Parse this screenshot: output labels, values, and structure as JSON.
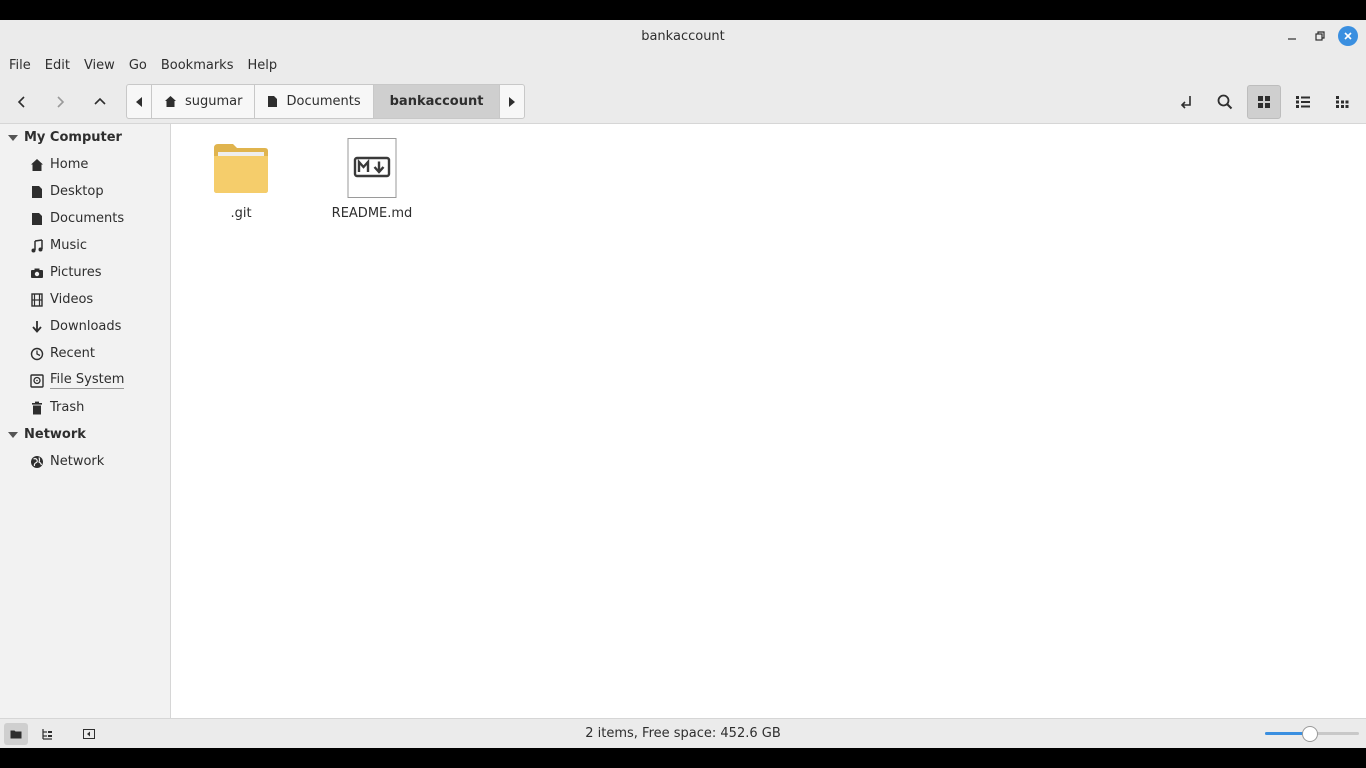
{
  "window": {
    "title": "bankaccount"
  },
  "menu": [
    "File",
    "Edit",
    "View",
    "Go",
    "Bookmarks",
    "Help"
  ],
  "breadcrumb": [
    "sugumar",
    "Documents",
    "bankaccount"
  ],
  "sidebar": {
    "sections": [
      {
        "label": "My Computer",
        "items": [
          {
            "label": "Home",
            "icon": "home-icon"
          },
          {
            "label": "Desktop",
            "icon": "desktop-icon"
          },
          {
            "label": "Documents",
            "icon": "document-icon"
          },
          {
            "label": "Music",
            "icon": "music-icon"
          },
          {
            "label": "Pictures",
            "icon": "camera-icon"
          },
          {
            "label": "Videos",
            "icon": "film-icon"
          },
          {
            "label": "Downloads",
            "icon": "download-icon"
          },
          {
            "label": "Recent",
            "icon": "clock-icon"
          },
          {
            "label": "File System",
            "icon": "drive-icon"
          },
          {
            "label": "Trash",
            "icon": "trash-icon"
          }
        ]
      },
      {
        "label": "Network",
        "items": [
          {
            "label": "Network",
            "icon": "globe-icon"
          }
        ]
      }
    ]
  },
  "files": [
    {
      "name": ".git",
      "type": "folder"
    },
    {
      "name": "README.md",
      "type": "markdown"
    }
  ],
  "status": {
    "text": "2 items, Free space: 452.6 GB",
    "zoom_level": 0.48
  },
  "colors": {
    "accent": "#3a8fe0",
    "folder": "#f5cd6b",
    "folder_dark": "#e0b44e"
  }
}
